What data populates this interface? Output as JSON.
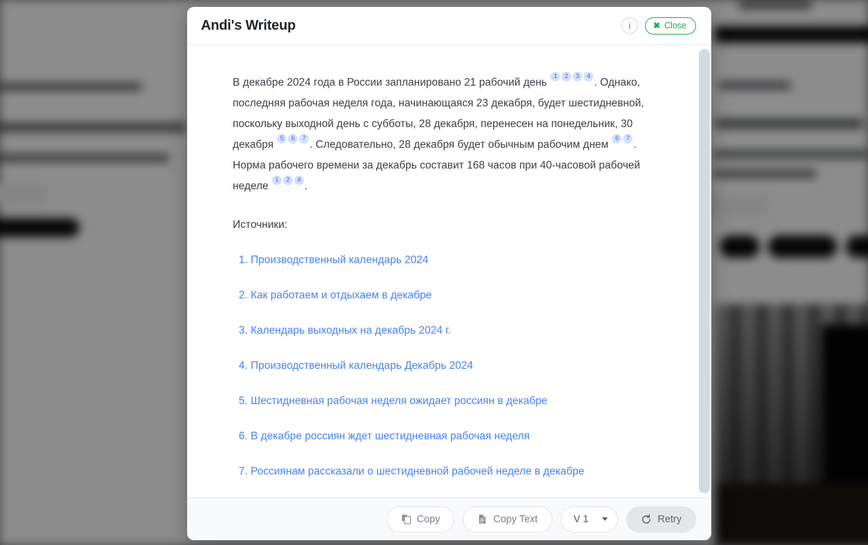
{
  "modal": {
    "title": "Andi's Writeup",
    "header": {
      "info_label": "i",
      "close_label": "Close",
      "close_icon": "close-x-icon"
    },
    "content": {
      "paragraph_parts": {
        "p1_a": "В декабре 2024 года в России запланировано 21 рабочий день ",
        "p1_cites_1": [
          "1",
          "2",
          "3",
          "4"
        ],
        "p1_b": ". Однако, последняя рабочая неделя года, начинающаяся 23 декабря, будет шестидневной, поскольку выходной день с субботы, 28 декабря, перенесен на понедельник, 30 декабря ",
        "p1_cites_2": [
          "5",
          "6",
          "7"
        ],
        "p1_c": ". Следовательно, 28 декабря будет обычным рабочим днем ",
        "p1_cites_3": [
          "6",
          "7"
        ],
        "p1_d": ". Норма рабочего времени за декабрь составит 168 часов при 40-часовой рабочей неделе ",
        "p1_cites_4": [
          "1",
          "2",
          "4"
        ],
        "p1_e": "."
      },
      "sources_label": "Источники:",
      "sources": [
        "Производственный календарь 2024",
        "Как работаем и отдыхаем в декабре",
        "Календарь выходных на декабрь 2024 г.",
        "Производственный календарь Декабрь 2024",
        "Шестидневная рабочая неделя ожидает россиян в декабре",
        "В декабре россиян ждет шестидневная рабочая неделя",
        "Россиянам рассказали о шестидневной рабочей неделе в декабре"
      ]
    },
    "footer": {
      "copy_label": "Copy",
      "copy_text_label": "Copy Text",
      "version_label": "V 1",
      "retry_label": "Retry"
    }
  },
  "colors": {
    "accent_green": "#28a745",
    "link_blue": "#4a81f0",
    "citation_bg": "#d5e1fb",
    "citation_fg": "#3b6fd4",
    "footer_bg": "#f8f9fb",
    "scrollbar": "#d4dae2"
  }
}
